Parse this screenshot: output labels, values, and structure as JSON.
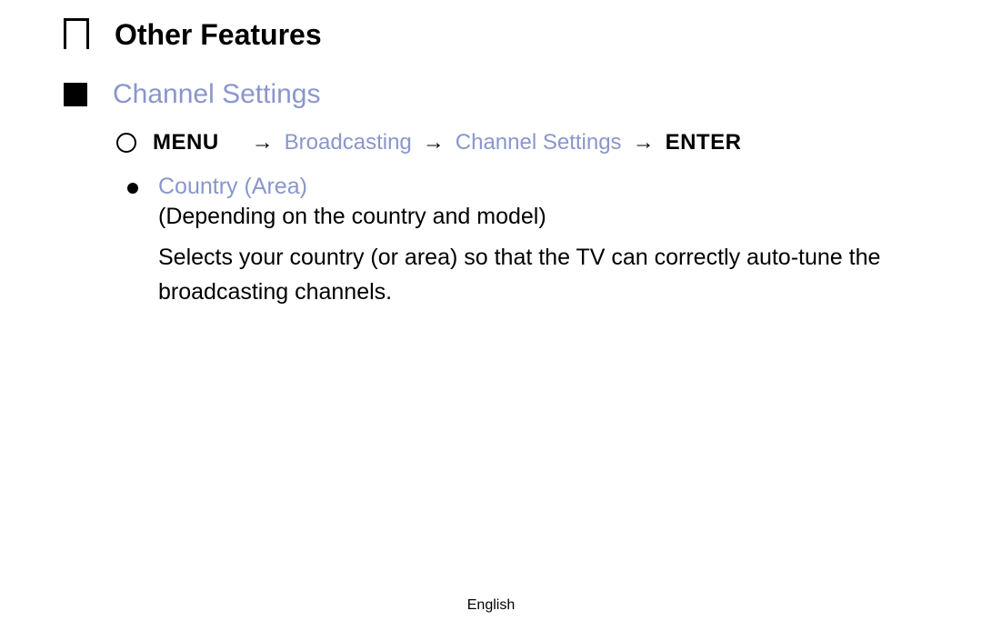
{
  "heading": {
    "main": "Other Features",
    "sub": "Channel Settings"
  },
  "navPath": {
    "menu": "MENU",
    "arrow": "→",
    "step1": "Broadcasting",
    "step2": "Channel Settings",
    "enter": "ENTER"
  },
  "bullet": {
    "title": "Country (Area)",
    "subtext": "(Depending on the country and model)",
    "description": "Selects your country (or area) so that the TV can correctly auto-tune the broadcasting channels."
  },
  "footer": {
    "language": "English"
  }
}
